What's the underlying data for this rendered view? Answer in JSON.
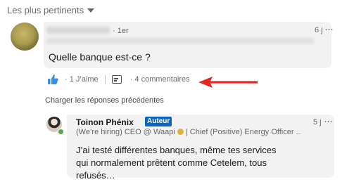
{
  "sort": {
    "label": "Les plus pertinents"
  },
  "comment": {
    "degree": "· 1er",
    "time": "6 j",
    "more_label": "···",
    "text": "Quelle banque est-ce ?",
    "actions": {
      "like_label": "· 1 J’aime",
      "comments_label": "· 4 commentaires"
    }
  },
  "load_previous": "Charger les réponses précédentes",
  "reply": {
    "author": "Toinon Phénix",
    "badge": "Auteur",
    "headline_part1": "(We’re hiring) CEO @ Waapi ",
    "headline_part2": " | Chief (Positive) Energy Officer ...",
    "time": "5 j",
    "more_label": "···",
    "text": "J’ai testé différentes banques, même tes services qui normalement prêtent comme Cetelem, tous refusés…"
  },
  "colors": {
    "accent": "#0a66c2",
    "like_icon": "#378fe9",
    "arrow": "#e3261f",
    "online": "#57a64b"
  },
  "icons": {
    "sort": "chevron-down-icon",
    "like": "thumbs-up-icon",
    "comment": "comment-icon",
    "annotation": "red-arrow-icon"
  }
}
